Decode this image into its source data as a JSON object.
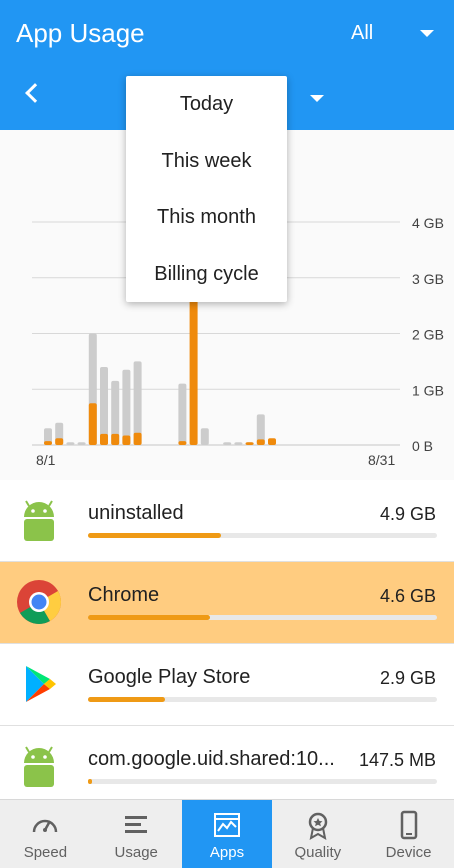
{
  "header": {
    "title": "App Usage",
    "filter_value": "All"
  },
  "period_menu": {
    "items": [
      "Today",
      "This week",
      "This month",
      "Billing cycle"
    ]
  },
  "chart_data": {
    "type": "bar",
    "x_start_label": "8/1",
    "x_end_label": "8/31",
    "y_tick_labels": [
      "0 B",
      "1 GB",
      "2 GB",
      "3 GB",
      "4 GB"
    ],
    "ylim": [
      0,
      4
    ],
    "unit": "GB",
    "days": [
      1,
      2,
      3,
      4,
      5,
      6,
      7,
      8,
      9,
      10,
      11,
      12,
      13,
      14,
      15,
      16,
      17,
      18,
      19,
      20,
      21,
      22,
      23,
      24,
      25,
      26,
      27,
      28,
      29,
      30,
      31
    ],
    "series": [
      {
        "values": [
          0.3,
          0.4,
          0.05,
          0.05,
          2.0,
          1.4,
          1.15,
          1.35,
          1.5,
          0,
          0,
          0,
          1.1,
          0,
          0.3,
          0,
          0.05,
          0.05,
          0.05,
          0.55,
          0.1,
          0,
          0,
          0,
          0,
          0,
          0,
          0,
          0,
          0,
          0
        ]
      },
      {
        "values": [
          0.07,
          0.12,
          0,
          0,
          0.75,
          0.2,
          0.2,
          0.17,
          0.22,
          0,
          0,
          0,
          0.07,
          3.6,
          0,
          0,
          0,
          0,
          0.05,
          0.1,
          0.12,
          0,
          0,
          0,
          0,
          0,
          0,
          0,
          0,
          0,
          0
        ]
      }
    ],
    "colors": {
      "total": "#cccccc",
      "app": "#ef8a0c",
      "grid": "#d8d8d8"
    }
  },
  "apps": [
    {
      "name": "uninstalled",
      "size": "4.9 GB",
      "fraction": 0.38,
      "icon": "android-icon",
      "selected": false
    },
    {
      "name": "Chrome",
      "size": "4.6 GB",
      "fraction": 0.35,
      "icon": "chrome-icon",
      "selected": true
    },
    {
      "name": "Google Play Store",
      "size": "2.9 GB",
      "fraction": 0.22,
      "icon": "play-store-icon",
      "selected": false
    },
    {
      "name": "com.google.uid.shared:10...",
      "size": "147.5 MB",
      "fraction": 0.01,
      "icon": "android-icon",
      "selected": false
    }
  ],
  "bottom_nav": [
    {
      "label": "Speed",
      "icon": "speedometer-icon",
      "active": false
    },
    {
      "label": "Usage",
      "icon": "usage-list-icon",
      "active": false
    },
    {
      "label": "Apps",
      "icon": "apps-chart-icon",
      "active": true
    },
    {
      "label": "Quality",
      "icon": "quality-badge-icon",
      "active": false
    },
    {
      "label": "Device",
      "icon": "phone-icon",
      "active": false
    }
  ],
  "colors": {
    "accent": "#2196f3",
    "highlight": "#ffcc80",
    "bar": "#ef9a15"
  }
}
